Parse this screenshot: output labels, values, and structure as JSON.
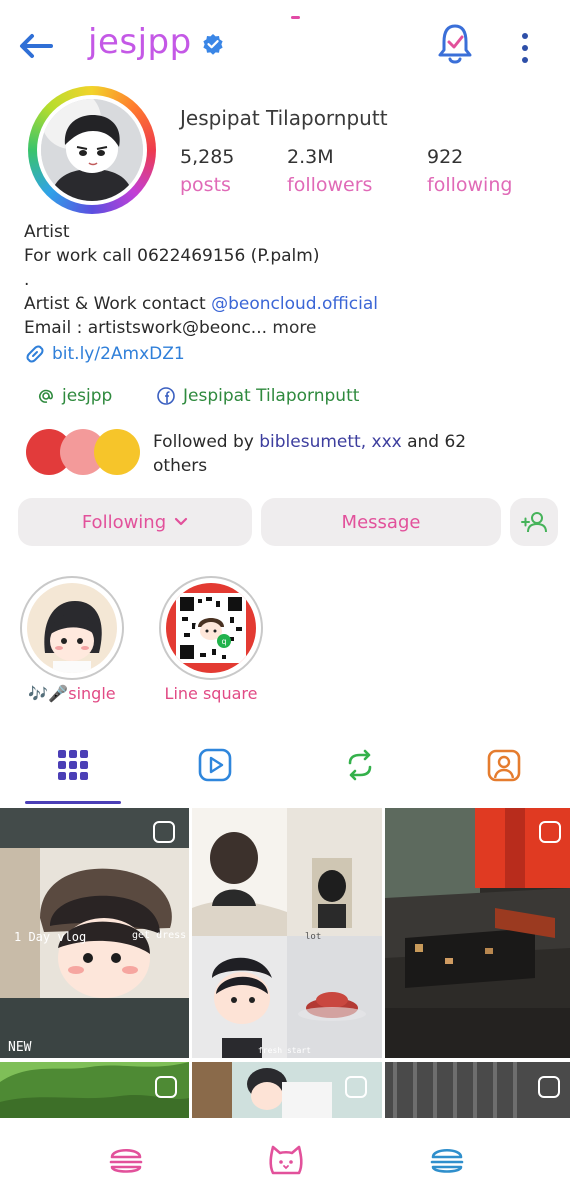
{
  "header": {
    "username": "jesjpp",
    "back_icon": "arrow-left-icon",
    "verified_icon": "verified-badge-icon",
    "bell_icon": "bell-icon",
    "more_icon": "more-vertical-icon"
  },
  "profile": {
    "full_name": "Jespipat Tilapornputt",
    "stats": [
      {
        "value": "5,285",
        "label": "posts"
      },
      {
        "value": "2.3M",
        "label": "followers"
      },
      {
        "value": "922",
        "label": "following"
      }
    ]
  },
  "bio": {
    "line1": "Artist",
    "line2": "For work call 0622469156 (P.palm)",
    "line3": ".",
    "line4_prefix": "Artist & Work contact ",
    "line4_mention": "@beoncloud.official",
    "line5_prefix": "Email : artistswork@beonc... ",
    "line5_more": "more",
    "link": "bit.ly/2AmxDZ1"
  },
  "social": {
    "threads_handle": "jesjpp",
    "facebook_name": "Jespipat Tilapornputt"
  },
  "followed_by": {
    "prefix": "Followed by ",
    "names": "biblesumett, xxx",
    "suffix": " and 62 others"
  },
  "buttons": {
    "following": "Following",
    "message": "Message",
    "add_person_icon": "add-person-icon"
  },
  "highlights": [
    {
      "label": "🎶🎤single"
    },
    {
      "label": "Line square"
    }
  ],
  "tabs": [
    {
      "icon": "grid-icon"
    },
    {
      "icon": "reels-icon"
    },
    {
      "icon": "repost-icon"
    },
    {
      "icon": "tagged-icon"
    }
  ],
  "grid": {
    "tile1_caption_left": "1 Day vlog",
    "tile1_caption_right": "get dress",
    "tile1_new": "NEW",
    "tile2_caption_a": "lot",
    "tile2_caption_b": "fresh start"
  },
  "bottom_nav": [
    {
      "icon": "burger-icon"
    },
    {
      "icon": "cat-face-icon"
    },
    {
      "icon": "stack-icon"
    }
  ],
  "colors": {
    "username": "#c458e6",
    "label_pink": "#e06ab7",
    "mention_blue": "#3b66d6",
    "tab_active": "#4b3fb6"
  }
}
